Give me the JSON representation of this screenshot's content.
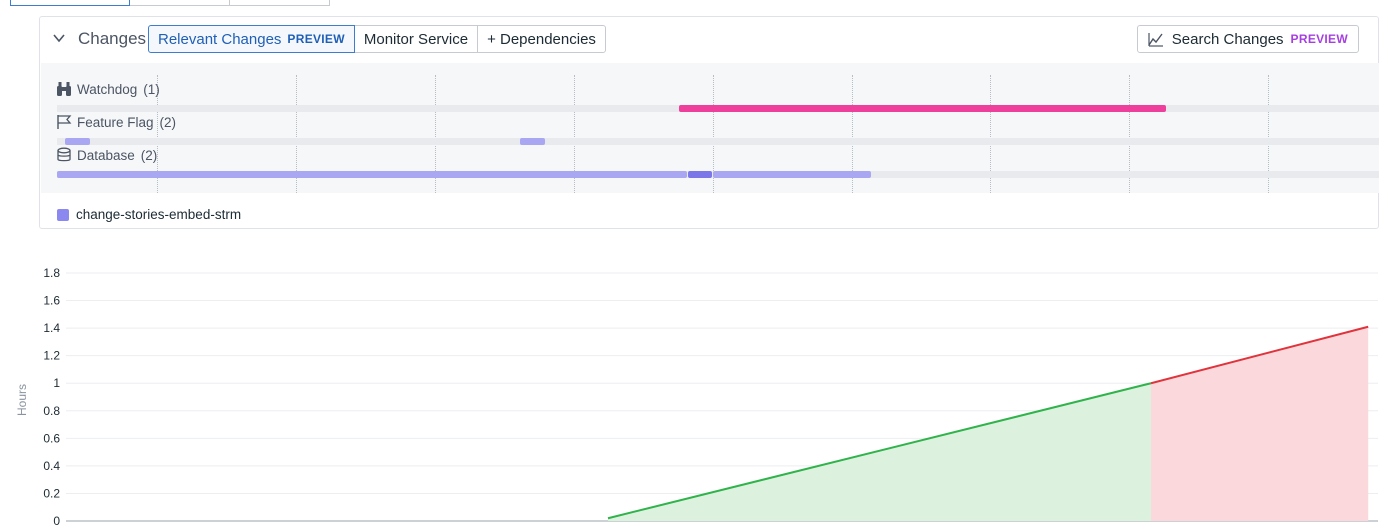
{
  "changes": {
    "title": "Changes",
    "toggle": {
      "options": [
        {
          "label": "Relevant Changes",
          "badge": "PREVIEW"
        },
        {
          "label": "Monitor Service"
        },
        {
          "label": "+ Dependencies"
        }
      ]
    },
    "search": {
      "label": "Search Changes",
      "badge": "PREVIEW"
    },
    "rows": [
      {
        "label": "Watchdog",
        "count": "(1)",
        "icon": "binoculars-icon"
      },
      {
        "label": "Feature Flag",
        "count": "(2)",
        "icon": "flag-icon"
      },
      {
        "label": "Database",
        "count": "(2)",
        "icon": "database-icon"
      }
    ],
    "legend": {
      "label": "change-stories-embed-strm",
      "color": "#8b88ef"
    },
    "colors": {
      "watchdog": "#ef3f9c",
      "change": "#a9a6f2",
      "change_dark": "#7b77e8"
    }
  },
  "chart_data": {
    "type": "area",
    "ylabel": "Hours",
    "ylim": [
      0,
      1.8
    ],
    "yticks": [
      "0",
      "0.2",
      "0.4",
      "0.6",
      "0.8",
      "1",
      "1.2",
      "1.4",
      "1.6",
      "1.8"
    ],
    "series": [
      {
        "color": "#2fb34a",
        "fill": "#dcf2df",
        "points": [
          [
            0,
            0.02
          ],
          [
            1,
            1.0
          ]
        ]
      },
      {
        "color": "#e0333b",
        "fill": "#fad8dc",
        "points": [
          [
            1,
            1.0
          ],
          [
            1.4,
            1.41
          ]
        ]
      }
    ]
  }
}
